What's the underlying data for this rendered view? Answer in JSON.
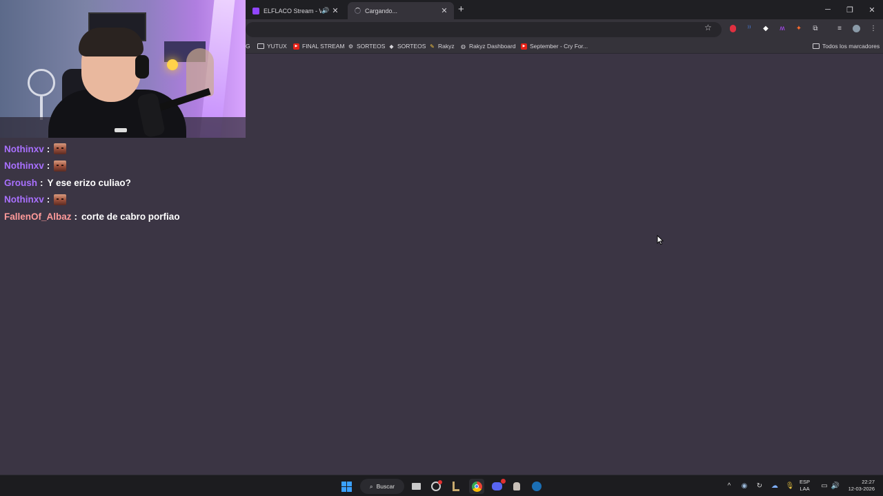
{
  "browser": {
    "tabs": [
      {
        "title": "ELFLACO Stream - Watch L",
        "state": "inactive"
      },
      {
        "title": "Cargando...",
        "state": "active"
      }
    ],
    "new_tab": "+",
    "window_controls": {
      "minimize": "─",
      "restore": "❐",
      "close": "✕"
    },
    "bookmarks": [
      {
        "label": "G",
        "icon": "truncated"
      },
      {
        "label": "YUTUX",
        "icon": "folder-icon"
      },
      {
        "label": "FINAL STREAM",
        "icon": "youtube-icon"
      },
      {
        "label": "SORTEOS",
        "icon": "gear-icon"
      },
      {
        "label": "SORTEOS",
        "icon": "diamond-icon"
      },
      {
        "label": "Rakyz",
        "icon": "pen-icon"
      },
      {
        "label": "Rakyz Dashboard",
        "icon": "globe-icon"
      },
      {
        "label": "September - Cry For...",
        "icon": "youtube-icon"
      }
    ],
    "all_bookmarks": "Todos los marcadores"
  },
  "chat": {
    "messages": [
      {
        "user": "Nothinxv",
        "text": "",
        "emote": true,
        "color": "#a970ff"
      },
      {
        "user": "Nothinxv",
        "text": "",
        "emote": true,
        "color": "#a970ff"
      },
      {
        "user": "Groush",
        "text": "Y ese erizo culiao?",
        "emote": false,
        "color": "#a970ff"
      },
      {
        "user": "Nothinxv",
        "text": "",
        "emote": true,
        "color": "#a970ff"
      },
      {
        "user": "FallenOf_Albaz",
        "text": "corte de cabro porfiao",
        "emote": false,
        "color": "#ff9a9a"
      }
    ],
    "separator": ":"
  },
  "taskbar": {
    "search_label": "Buscar",
    "language": {
      "line1": "ESP",
      "line2": "LAA"
    },
    "time": "22:27",
    "date": "12-03-2026"
  },
  "colors": {
    "page_background": "#3b3544",
    "accent": "#a970ff"
  }
}
